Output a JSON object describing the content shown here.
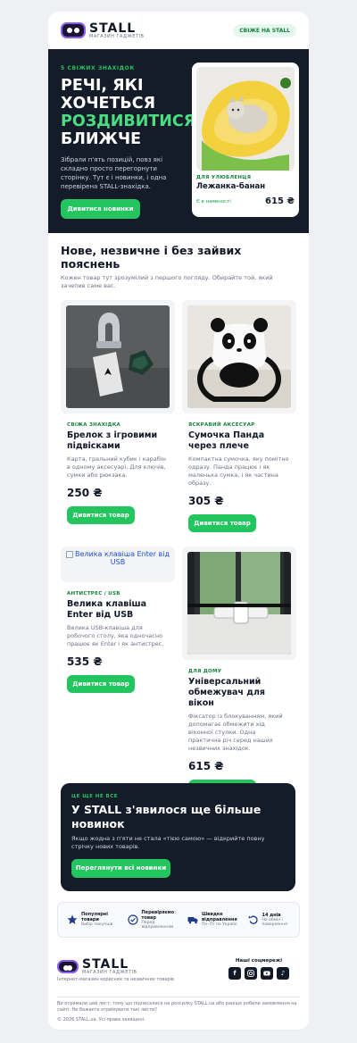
{
  "header": {
    "brand": "STALL",
    "brand_sub": "МАГАЗИН ГАДЖЕТІВ",
    "pill": "СВІЖЕ НА STALL"
  },
  "hero": {
    "eyebrow": "5 СВІЖИХ ЗНАХІДОК",
    "title_line1": "РЕЧІ, ЯКІ",
    "title_line2": "ХОЧЕТЬСЯ",
    "title_green": "РОЗДИВИТИСЯ",
    "title_line4": "БЛИЖЧЕ",
    "lead": "Зібрали п'ять позицій, повз які складно просто перегорнути сторінку. Тут є і новинки, і одна перевірена STALL-знахідка.",
    "button": "Дивитися новинки",
    "product": {
      "category": "ДЛЯ УЛЮБЛЕНЦЯ",
      "name": "Лежанка-банан",
      "stock": "Є в наявності",
      "price": "615 ₴"
    }
  },
  "section": {
    "title": "Нове, незвичне і без зайвих пояснень",
    "subtitle": "Кожен товар тут зрозумілий з першого погляду. Обирайте той, який зачепив саме вас."
  },
  "items": [
    {
      "tag": "СВІЖА ЗНАХІДКА",
      "title": "Брелок з ігровими підвісками",
      "desc": "Карта, гральний кубик і карабін в одному аксесуарі. Для ключів, сумки або рюкзака.",
      "price": "250 ₴",
      "button": "Дивитися товар"
    },
    {
      "tag": "ЯСКРАВИЙ АКСЕСУАР",
      "title": "Сумочка Панда через плече",
      "desc": "Компактна сумочка, яку помітно одразу. Панда працює і як маленька сумка, і як частина образу.",
      "price": "305 ₴",
      "button": "Дивитися товар"
    },
    {
      "img_alt": "Велика клавіша Enter від USB",
      "tag": "АНТИСТРЕС / USB",
      "title": "Велика клавіша Enter від USB",
      "desc": "Велика USB-клавіша для робочого столу, яка одночасно працює як Enter і як антистрес.",
      "price": "535 ₴",
      "button": "Дивитися товар"
    },
    {
      "tag": "ДЛЯ ДОМУ",
      "title": "Універсальний обмежувач для вікон",
      "desc": "Фіксатор із блокуванням, який допомагає обмежити хід віконної стулки. Одна практична річ серед наших незвичних знахідок.",
      "price": "615 ₴",
      "button": "Дивитися товар"
    }
  ],
  "cta": {
    "eyebrow": "ЦЕ ЩЕ НЕ ВСЕ",
    "title": "У STALL з'явилося ще більше новинок",
    "text": "Якщо жодна з п'яти не стала «тією самою» — відкрийте повну стрічку нових товарів.",
    "button": "Переглянути всі новинки"
  },
  "features": [
    {
      "icon": "star-icon",
      "title": "Популярні товари",
      "sub": "Вибір покупців"
    },
    {
      "icon": "check-circle-icon",
      "title": "Перевіряємо товар",
      "sub": "Перед відправленням"
    },
    {
      "icon": "truck-icon",
      "title": "Швидке відправлення",
      "sub": "Пн–Пт по Україні"
    },
    {
      "icon": "return-icon",
      "title": "14 днів",
      "sub": "На обмін і повернення"
    }
  ],
  "footer": {
    "brand": "STALL",
    "brand_sub": "МАГАЗИН ГАДЖЕТІВ",
    "tagline": "Інтернет-магазин корисних та незвичних товарів",
    "social_label": "Наші соцмережі",
    "legal": "Ви отримали цей лист, тому що підписалися на розсилку STALL.ua або раніше робили замовлення на сайті. Не бажаєте отримувати такі листи?",
    "copyright": "© 2026 STALL.ua. Усі права захищені."
  },
  "colors": {
    "accent": "#22c55e",
    "dark": "#141b29"
  }
}
